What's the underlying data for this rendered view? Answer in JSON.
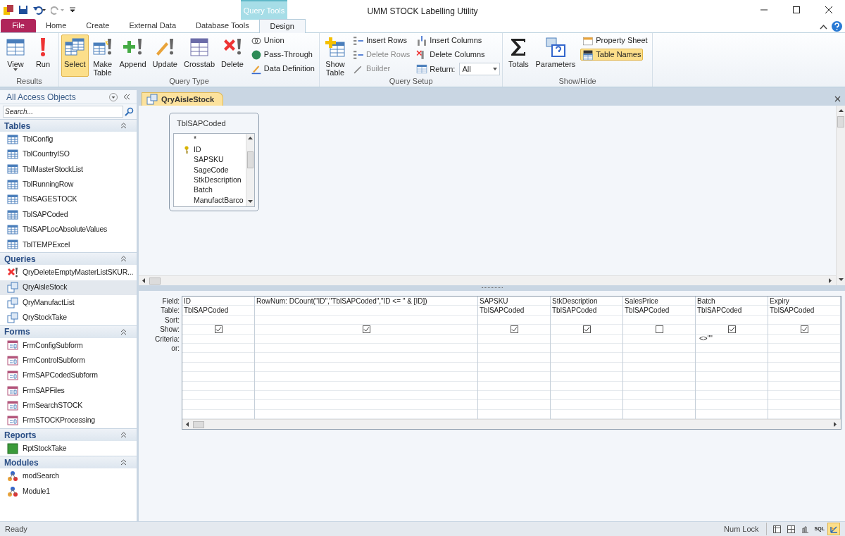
{
  "window": {
    "title": "UMM STOCK Labelling Utility",
    "context_tab": "Query Tools"
  },
  "ribbon_tabs": [
    {
      "label": "File",
      "kind": "file",
      "selected": false
    },
    {
      "label": "Home",
      "kind": "normal",
      "selected": false
    },
    {
      "label": "Create",
      "kind": "normal",
      "selected": false
    },
    {
      "label": "External Data",
      "kind": "normal",
      "selected": false
    },
    {
      "label": "Database Tools",
      "kind": "normal",
      "selected": false
    },
    {
      "label": "Design",
      "kind": "context",
      "selected": true
    }
  ],
  "ribbon_groups": [
    {
      "label": "Results",
      "items": [
        {
          "kind": "view",
          "label": "View",
          "dropdown": true,
          "selected": false,
          "disabled": false
        },
        {
          "kind": "run",
          "label": "Run",
          "selected": false,
          "disabled": false
        }
      ]
    },
    {
      "label": "Query Type",
      "items": [
        {
          "kind": "select",
          "label": "Select",
          "selected": true,
          "disabled": false
        },
        {
          "kind": "make",
          "label": "Make Table",
          "selected": false,
          "disabled": false
        },
        {
          "kind": "append",
          "label": "Append",
          "selected": false,
          "disabled": false
        },
        {
          "kind": "update",
          "label": "Update",
          "selected": false,
          "disabled": false
        },
        {
          "kind": "crosstab",
          "label": "Crosstab",
          "selected": false,
          "disabled": false
        },
        {
          "kind": "delete",
          "label": "Delete",
          "selected": false,
          "disabled": false
        },
        {
          "kind": "stack",
          "items": [
            {
              "kind": "union",
              "label": "Union",
              "selected": false,
              "disabled": false
            },
            {
              "kind": "globe",
              "label": "Pass-Through",
              "selected": false,
              "disabled": false
            },
            {
              "kind": "pencil",
              "label": "Data Definition",
              "selected": false,
              "disabled": false
            }
          ]
        }
      ]
    },
    {
      "label": "Query Setup",
      "items": [
        {
          "kind": "showtable",
          "label": "Show Table",
          "selected": false,
          "disabled": false
        },
        {
          "kind": "stack",
          "items": [
            {
              "kind": "rows",
              "label": "Insert Rows",
              "selected": false,
              "disabled": false
            },
            {
              "kind": "rows",
              "label": "Delete Rows",
              "selected": false,
              "disabled": true
            },
            {
              "kind": "wand",
              "label": "Builder",
              "selected": false,
              "disabled": true
            }
          ]
        },
        {
          "kind": "stack",
          "items": [
            {
              "kind": "cols",
              "label": "Insert Columns",
              "selected": false,
              "disabled": false
            },
            {
              "kind": "delcols",
              "label": "Delete Columns",
              "selected": false,
              "disabled": false
            },
            {
              "kind": "return",
              "label": "Return:",
              "selected": false,
              "disabled": false,
              "value": "All"
            }
          ]
        }
      ]
    },
    {
      "label": "Show/Hide",
      "items": [
        {
          "kind": "sigma",
          "label": "Totals",
          "selected": false,
          "disabled": false
        },
        {
          "kind": "params",
          "label": "Parameters",
          "selected": false,
          "disabled": false
        },
        {
          "kind": "stack",
          "items": [
            {
              "kind": "sheet",
              "label": "Property Sheet",
              "selected": false,
              "disabled": false
            },
            {
              "kind": "xyz",
              "label": "Table Names",
              "selected": true,
              "disabled": false
            }
          ]
        }
      ]
    }
  ],
  "nav": {
    "title": "All Access Objects",
    "search_placeholder": "Search...",
    "sections": [
      {
        "title": "Tables",
        "items": [
          {
            "label": "TblConfig",
            "kind": "table",
            "selected": false
          },
          {
            "label": "TblCountryISO",
            "kind": "table",
            "selected": false
          },
          {
            "label": "TblMasterStockList",
            "kind": "table",
            "selected": false
          },
          {
            "label": "TblRunningRow",
            "kind": "table",
            "selected": false
          },
          {
            "label": "TblSAGESTOCK",
            "kind": "table",
            "selected": false
          },
          {
            "label": "TblSAPCoded",
            "kind": "table",
            "selected": false
          },
          {
            "label": "TblSAPLocAbsoluteValues",
            "kind": "table",
            "selected": false
          },
          {
            "label": "TblTEMPExcel",
            "kind": "table",
            "selected": false
          }
        ]
      },
      {
        "title": "Queries",
        "items": [
          {
            "label": "QryDeleteEmptyMasterListSKUR...",
            "kind": "delete-query",
            "selected": false
          },
          {
            "label": "QryAisleStock",
            "kind": "query",
            "selected": true
          },
          {
            "label": "QryManufactList",
            "kind": "query",
            "selected": false
          },
          {
            "label": "QryStockTake",
            "kind": "query",
            "selected": false
          }
        ]
      },
      {
        "title": "Forms",
        "items": [
          {
            "label": "FrmConfigSubform",
            "kind": "form",
            "selected": false
          },
          {
            "label": "FrmControlSubform",
            "kind": "form",
            "selected": false
          },
          {
            "label": "FrmSAPCodedSubform",
            "kind": "form",
            "selected": false
          },
          {
            "label": "FrmSAPFiles",
            "kind": "form",
            "selected": false
          },
          {
            "label": "FrmSearchSTOCK",
            "kind": "form",
            "selected": false
          },
          {
            "label": "FrmSTOCKProcessing",
            "kind": "form",
            "selected": false
          }
        ]
      },
      {
        "title": "Reports",
        "items": [
          {
            "label": "RptStockTake",
            "kind": "report",
            "selected": false
          }
        ]
      },
      {
        "title": "Modules",
        "items": [
          {
            "label": "modSearch",
            "kind": "module",
            "selected": false
          },
          {
            "label": "Module1",
            "kind": "module",
            "selected": false
          }
        ]
      }
    ]
  },
  "document_tab": "QryAisleStock",
  "field_list": {
    "title": "TblSAPCoded",
    "fields": [
      {
        "label": "*",
        "primary_key": false
      },
      {
        "label": "ID",
        "primary_key": true
      },
      {
        "label": "SAPSKU",
        "primary_key": false
      },
      {
        "label": "SageCode",
        "primary_key": false
      },
      {
        "label": "StkDescription",
        "primary_key": false
      },
      {
        "label": "Batch",
        "primary_key": false
      },
      {
        "label": "ManufactBarco",
        "primary_key": false
      }
    ]
  },
  "grid": {
    "row_labels": [
      "Field:",
      "Table:",
      "Sort:",
      "Show:",
      "Criteria:",
      "or:"
    ],
    "columns": [
      {
        "field": "ID",
        "table": "TblSAPCoded",
        "show": true
      },
      {
        "field": "RowNum: DCount(\"ID\",\"TblSAPCoded\",\"ID <= \" & [ID])",
        "show": true
      },
      {
        "field": "SAPSKU",
        "table": "TblSAPCoded",
        "show": true
      },
      {
        "field": "StkDescription",
        "table": "TblSAPCoded",
        "show": true
      },
      {
        "field": "SalesPrice",
        "table": "TblSAPCoded",
        "show": false
      },
      {
        "field": "Batch",
        "table": "TblSAPCoded",
        "show": true,
        "criteria": "<>\"\""
      },
      {
        "field": "Expiry",
        "table": "TblSAPCoded",
        "show": true
      }
    ]
  },
  "status_bar": {
    "text": "Ready",
    "num_lock": "Num Lock",
    "views": [
      {
        "kind": "datasheet",
        "selected": false
      },
      {
        "kind": "pivot-table",
        "selected": false
      },
      {
        "kind": "pivot-chart",
        "selected": false
      },
      {
        "kind": "sql",
        "label": "SQL",
        "selected": false
      },
      {
        "kind": "design",
        "selected": true
      }
    ]
  }
}
